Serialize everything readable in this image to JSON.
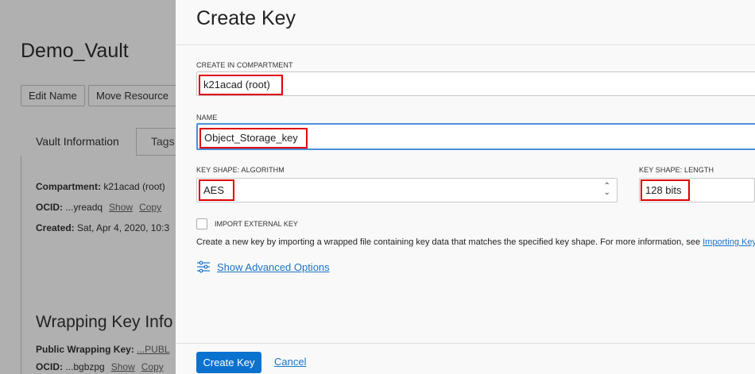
{
  "background": {
    "title": "Demo_Vault",
    "buttons": [
      "Edit Name",
      "Move Resource"
    ],
    "tabs": [
      "Vault Information",
      "Tags"
    ],
    "compartment_label": "Compartment:",
    "compartment_value": "k21acad (root)",
    "ocid_label": "OCID:",
    "ocid_value": "...yreadq",
    "show": "Show",
    "copy": "Copy",
    "created_label": "Created:",
    "created_value": "Sat, Apr 4, 2020, 10:3",
    "wrapping_title": "Wrapping Key Info",
    "public_key_label": "Public Wrapping Key:",
    "public_key_value": "...PUBL",
    "ocid2_value": "...bgbzpg"
  },
  "panel": {
    "title": "Create Key",
    "compartment_label": "CREATE IN COMPARTMENT",
    "compartment_value": "k21acad (root)",
    "name_label": "NAME",
    "name_value": "Object_Storage_key",
    "algorithm_label": "KEY SHAPE: ALGORITHM",
    "algorithm_value": "AES",
    "length_label": "KEY SHAPE: LENGTH",
    "length_value": "128 bits",
    "import_label": "IMPORT EXTERNAL KEY",
    "import_checked": false,
    "help_text": "Create a new key by importing a wrapped file containing key data that matches the specified key shape. For more information, see ",
    "help_link": "Importing Keys",
    "help_end": ".",
    "advanced": "Show Advanced Options",
    "create_button": "Create Key",
    "cancel": "Cancel"
  }
}
